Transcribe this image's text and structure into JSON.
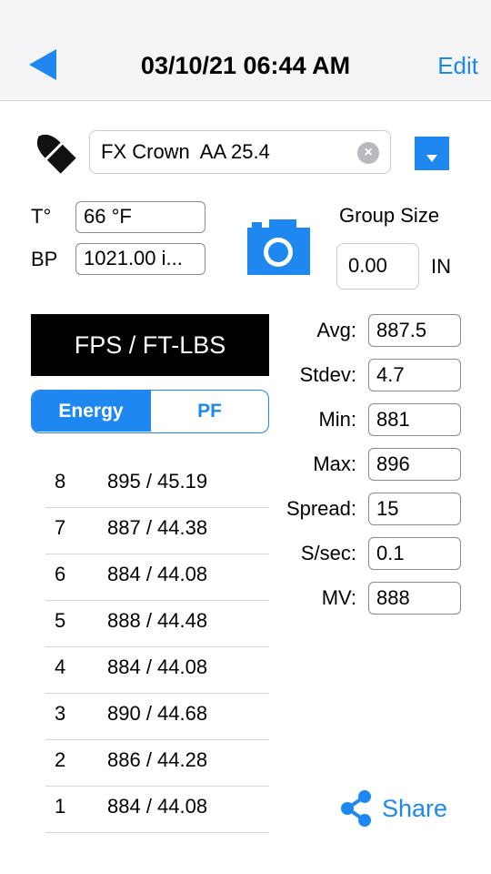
{
  "header": {
    "title": "03/10/21 06:44 AM",
    "edit_label": "Edit"
  },
  "ammo": {
    "value": "FX Crown  AA 25.4"
  },
  "temperature": {
    "label": "T°",
    "value": "66 °F"
  },
  "pressure": {
    "label": "BP",
    "value": "1021.00 i..."
  },
  "group": {
    "label": "Group Size",
    "value": "0.00",
    "unit": "IN"
  },
  "units_button": "FPS / FT-LBS",
  "segment": {
    "energy": "Energy",
    "pf": "PF",
    "selected": "Energy"
  },
  "stats": [
    {
      "label": "Avg:",
      "value": "887.5"
    },
    {
      "label": "Stdev:",
      "value": "4.7"
    },
    {
      "label": "Min:",
      "value": "881"
    },
    {
      "label": "Max:",
      "value": "896"
    },
    {
      "label": "Spread:",
      "value": "15"
    },
    {
      "label": "S/sec:",
      "value": "0.1"
    },
    {
      "label": "MV:",
      "value": "888"
    }
  ],
  "shots": [
    {
      "num": "8",
      "value": "895 / 45.19"
    },
    {
      "num": "7",
      "value": "887 / 44.38"
    },
    {
      "num": "6",
      "value": "884 / 44.08"
    },
    {
      "num": "5",
      "value": "888 / 44.48"
    },
    {
      "num": "4",
      "value": "884 / 44.08"
    },
    {
      "num": "3",
      "value": "890 / 44.68"
    },
    {
      "num": "2",
      "value": "886 / 44.28"
    },
    {
      "num": "1",
      "value": "884 / 44.08"
    }
  ],
  "share_label": "Share",
  "colors": {
    "accent": "#1e88f0",
    "black_button": "#000000"
  }
}
